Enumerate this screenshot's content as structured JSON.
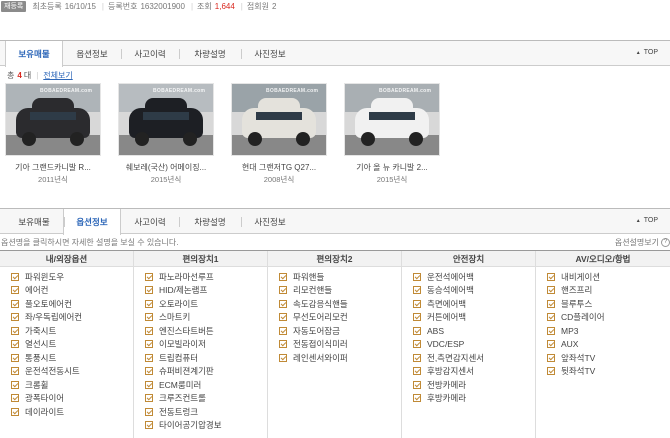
{
  "meta": {
    "badge": "재등록",
    "first_reg_label": "최초등록",
    "first_reg_value": "16/10/15",
    "reg_no_label": "등록번호",
    "reg_no_value": "1632001900",
    "views_label": "조회",
    "views_value": "1,644",
    "members_label": "접회원",
    "members_value": "2"
  },
  "tabs": [
    {
      "label": "보유매물"
    },
    {
      "label": "옵션정보"
    },
    {
      "label": "사고이력"
    },
    {
      "label": "차량설명"
    },
    {
      "label": "사진정보"
    }
  ],
  "top_link": "TOP",
  "listing": {
    "total_label": "총",
    "total_count": "4",
    "total_unit": "대",
    "view_all": "전체보기"
  },
  "cars": [
    {
      "name": "기아 그랜드카니발 R...",
      "year": "2011년식",
      "body_color": "#2b2b2e",
      "sky_color": "#aeb4b8"
    },
    {
      "name": "쉐보레(국산) 어메이징...",
      "year": "2015년식",
      "body_color": "#1d1f24",
      "sky_color": "#b7bcc0"
    },
    {
      "name": "현대 그랜저TG Q27...",
      "year": "2008년식",
      "body_color": "#e4e2dc",
      "sky_color": "#9aa3a8"
    },
    {
      "name": "기아 올 뉴 카니발 2...",
      "year": "2015년식",
      "body_color": "#f1f1f1",
      "sky_color": "#a9afb3"
    }
  ],
  "watermark": "BOBAEDREAM.com",
  "hint": "옵션명을 클릭하시면 자세한 설명을 보실 수 있습니다.",
  "guide": "옵션설명보기",
  "guide_icon": "?",
  "options": [
    {
      "title": "내/외장옵션",
      "items": [
        "파워윈도우",
        "에어컨",
        "풀오토에어컨",
        "좌/우독립에어컨",
        "가죽시트",
        "열선시트",
        "통풍시트",
        "운전석전동시트",
        "크롬휠",
        "광폭타이어",
        "데이라이트"
      ]
    },
    {
      "title": "편의장치1",
      "items": [
        "파노라마선루프",
        "HID/제논램프",
        "오토라이트",
        "스마트키",
        "엔진스타트버튼",
        "이모빌라이저",
        "트립컴퓨터",
        "슈퍼비젼계기판",
        "ECM룸미러",
        "크루즈컨트롤",
        "전동트렁크",
        "타이어공기압경보"
      ]
    },
    {
      "title": "편의장치2",
      "items": [
        "파워핸들",
        "리모컨핸들",
        "속도감응식핸들",
        "무선도어리모컨",
        "자동도어잠금",
        "전동접이식미러",
        "레인센서와이퍼"
      ]
    },
    {
      "title": "안전장치",
      "items": [
        "운전석에어백",
        "동승석에어백",
        "측면에어백",
        "커튼에어백",
        "ABS",
        "VDC/ESP",
        "전,측면감지센서",
        "후방감지센서",
        "전방카메라",
        "후방카메라"
      ]
    },
    {
      "title": "AV/오디오/항법",
      "items": [
        "내비게이션",
        "핸즈프리",
        "블루투스",
        "CD플레이어",
        "MP3",
        "AUX",
        "앞좌석TV",
        "뒷좌석TV"
      ]
    }
  ]
}
